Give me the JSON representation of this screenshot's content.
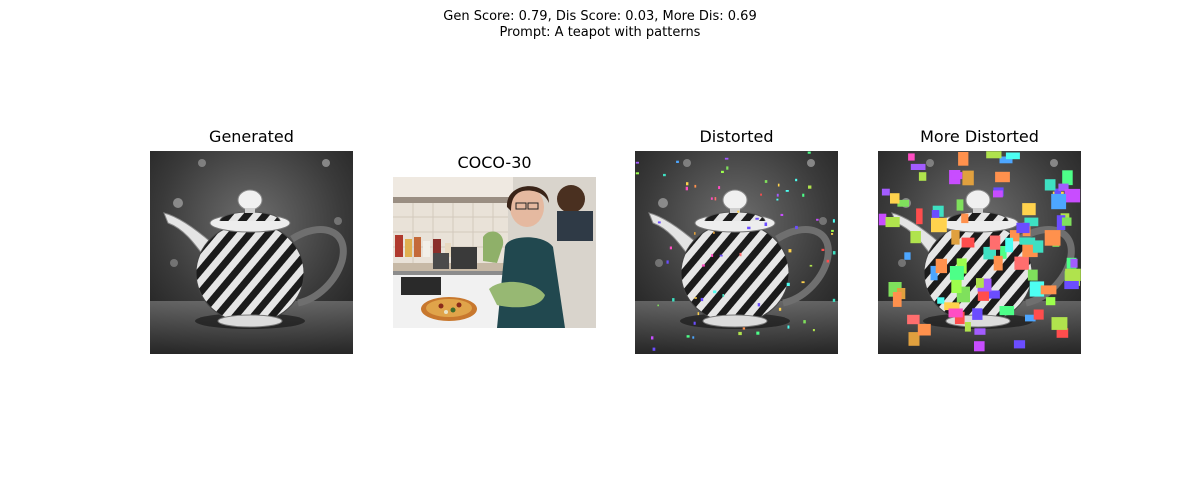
{
  "figure": {
    "suptitle_line1": "Gen Score: 0.79, Dis Score: 0.03, More Dis: 0.69",
    "suptitle_line2": "Prompt: A teapot with patterns",
    "panels": [
      {
        "title": "Generated"
      },
      {
        "title": "COCO-30"
      },
      {
        "title": "Distorted"
      },
      {
        "title": "More Distorted"
      }
    ]
  },
  "colors": {
    "background": "#ffffff",
    "teapot_bg_dark": "#2b2b2b",
    "teapot_bg_light": "#8a8a8a",
    "stripe_dark": "#1a1a1a",
    "stripe_light": "#e8e8e8"
  },
  "distortion_palette": [
    "#ff4d4d",
    "#4dff88",
    "#4da6ff",
    "#ffd24d",
    "#c84dff",
    "#4dfff2",
    "#ff4dc3",
    "#9dff4d",
    "#ff914d",
    "#6b4dff",
    "#b0e34d",
    "#ff6e6e",
    "#3ee0c2",
    "#e0a03e",
    "#a35cff",
    "#7fe05c"
  ]
}
